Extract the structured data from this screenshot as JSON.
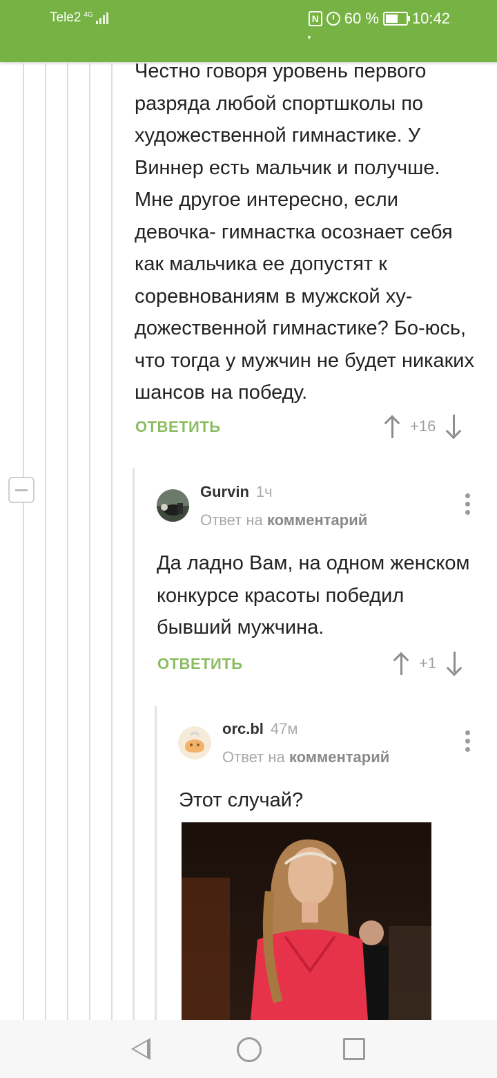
{
  "status_bar": {
    "carrier": "Tele2",
    "network_type": "4G",
    "battery_percent": "60 %",
    "battery_level": 0.6,
    "time": "10:42",
    "icons": [
      "nfc-icon",
      "alarm-icon",
      "battery-icon",
      "signal-icon"
    ]
  },
  "comments": [
    {
      "text": "Честно говоря уровень первого разряда любой спортшколы по художественной гимнастике. У Виннер есть мальчик и получше. Мне другое интересно, если девочка- гимнастка осознает себя как мальчика  ее допустят к соревнованиям в мужской ху-дожественной гимнастике? Бо-юсь, что тогда у мужчин не будет никаких шансов на победу.",
      "reply_label": "ОТВЕТИТЬ",
      "rating": "+16"
    },
    {
      "author": "Gurvin",
      "time": "1ч",
      "reply_to_prefix": "Ответ на",
      "reply_to_target": "комментарий",
      "text": "Да ладно Вам, на одном женском конкурсе красоты победил бывший мужчина.",
      "reply_label": "ОТВЕТИТЬ",
      "rating": "+1"
    },
    {
      "author": "orc.bl",
      "time": "47м",
      "reply_to_prefix": "Ответ на",
      "reply_to_target": "комментарий",
      "text": "Этот случай?"
    }
  ],
  "colors": {
    "accent": "#77b344",
    "reply_link": "#8bbd5f"
  }
}
